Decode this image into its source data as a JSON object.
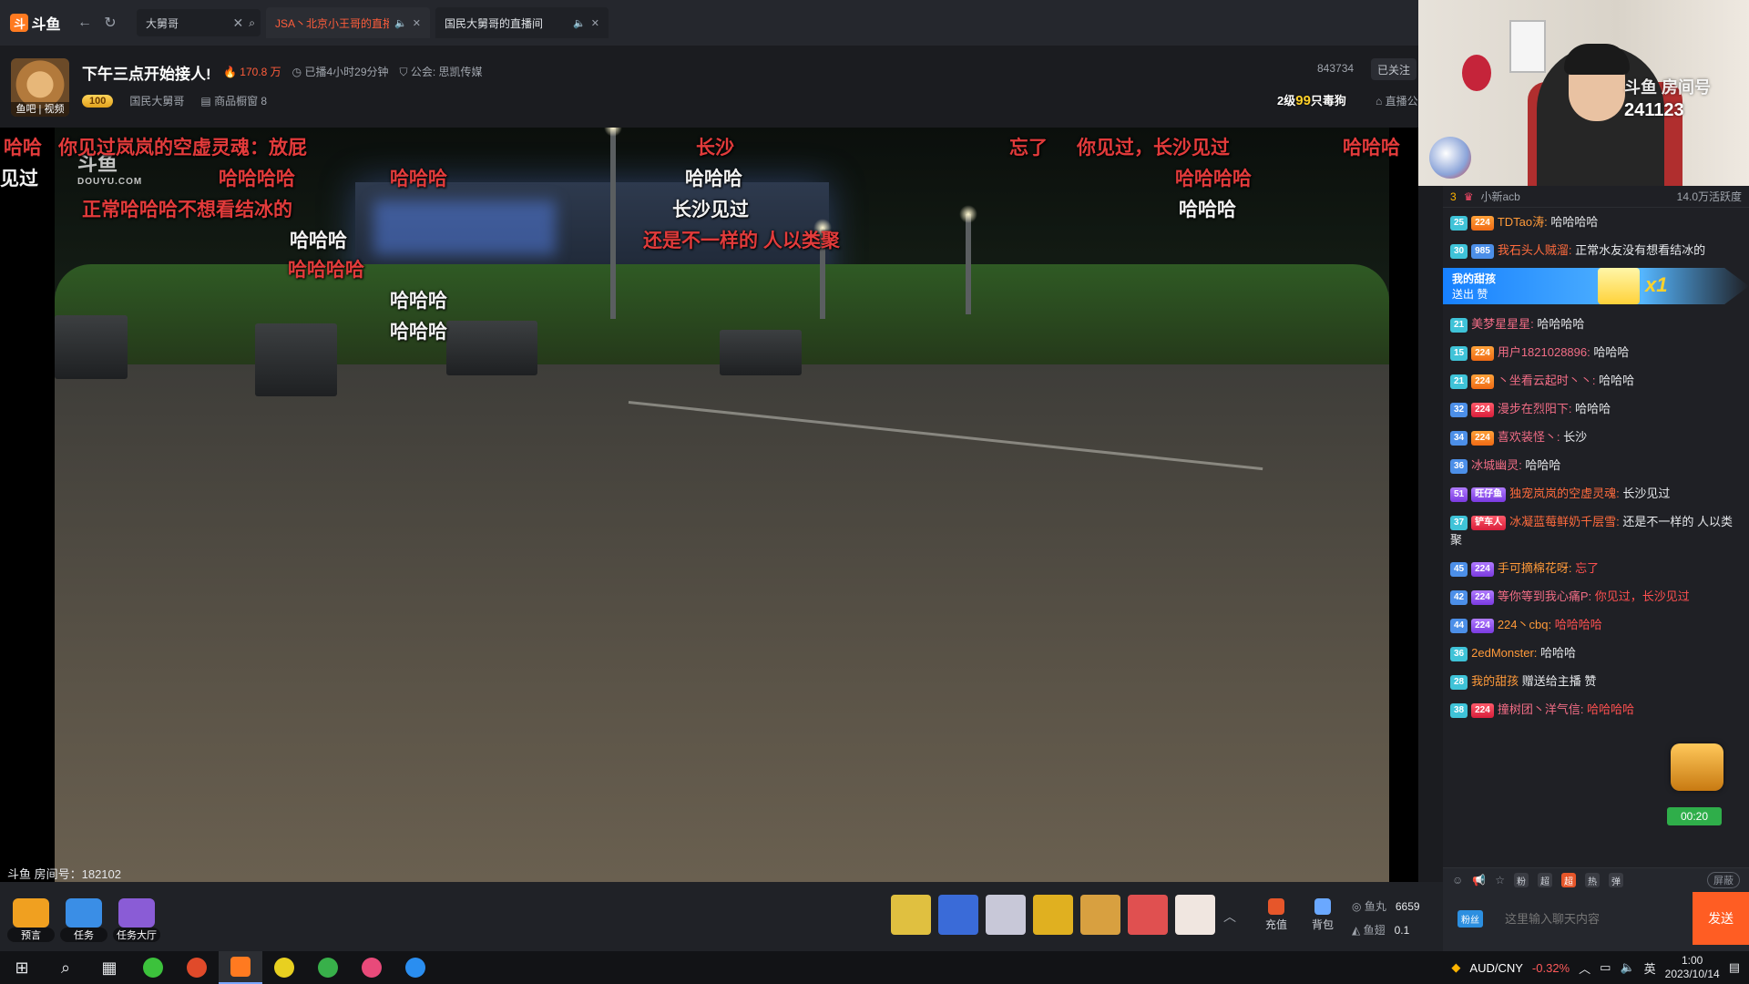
{
  "app": {
    "logo": "斗鱼",
    "brand_color": "#ff7a20"
  },
  "nav": {
    "back": "←",
    "refresh": "↻"
  },
  "search": {
    "value": "大舅哥"
  },
  "tabs": [
    {
      "label": "JSA丶北京小王哥的直播间",
      "active": true
    },
    {
      "label": "国民大舅哥的直播间",
      "active": false
    }
  ],
  "room": {
    "avatar_tag": "鱼吧 | 视频",
    "title": "下午三点开始接人!",
    "heat": "170.8 万",
    "duration": "已播4小时29分钟",
    "guild": "公会: 思凯传媒",
    "level_badge": "100",
    "anchor_name": "国民大舅哥",
    "shop": "商品橱窗 8",
    "viewer_id": "843734",
    "follow_label": "已关注",
    "gift_rank_prefix": "2级",
    "gift_rank_value": "99",
    "gift_rank_suffix": "只毒狗",
    "live_link": "直播公"
  },
  "video": {
    "watermark": "斗鱼",
    "watermark_sub": "DOUYU.COM",
    "room_number": "斗鱼 房间号：182102",
    "danmaku": [
      {
        "text": "哈哈",
        "color": "red",
        "pos": "a"
      },
      {
        "text": "你见过岚岚的空虚灵魂：放屁",
        "color": "red",
        "pos": "b"
      },
      {
        "text": "见过",
        "color": "white",
        "pos": "c"
      },
      {
        "text": "哈哈哈哈",
        "color": "red",
        "pos": "d"
      },
      {
        "text": "哈哈哈",
        "color": "red",
        "pos": "e"
      },
      {
        "text": "正常哈哈哈不想看结冰的",
        "color": "red",
        "pos": "f"
      },
      {
        "text": "哈哈哈",
        "color": "white",
        "pos": "g"
      },
      {
        "text": "哈哈哈哈",
        "color": "red",
        "pos": "h"
      },
      {
        "text": "哈哈哈",
        "color": "white",
        "pos": "i"
      },
      {
        "text": "哈哈哈",
        "color": "white",
        "pos": "j"
      },
      {
        "text": "长沙",
        "color": "red",
        "pos": "k"
      },
      {
        "text": "哈哈哈",
        "color": "white",
        "pos": "l"
      },
      {
        "text": "长沙见过",
        "color": "white",
        "pos": "m"
      },
      {
        "text": "还是不一样的 人以类聚",
        "color": "red",
        "pos": "n"
      },
      {
        "text": "忘了",
        "color": "red",
        "pos": "o"
      },
      {
        "text": "你见过，长沙见过",
        "color": "red",
        "pos": "p"
      },
      {
        "text": "哈哈哈哈",
        "color": "red",
        "pos": "q"
      },
      {
        "text": "哈哈哈",
        "color": "white",
        "pos": "r"
      },
      {
        "text": "哈哈哈",
        "color": "red",
        "pos": "s"
      }
    ]
  },
  "cam": {
    "watermark": "斗鱼",
    "room_label": "房间号",
    "room_number": "241123"
  },
  "chat": {
    "header_rank": "3",
    "header_user": "小新acb",
    "header_active": "14.0万活跃度",
    "gift_banner": {
      "line1": "我的甜孩",
      "line2": "送出 赞",
      "count": "x1"
    },
    "messages": [
      {
        "lv": "25",
        "fan": "224",
        "nick": "TDTao涛:",
        "text": "哈哈哈哈"
      },
      {
        "lv": "30",
        "fan": "985",
        "nick": "我石头人贼溜:",
        "text": "正常水友没有想看结冰的"
      },
      {
        "lv": "21",
        "fan": "",
        "nick": "美梦星星星:",
        "text": "哈哈哈哈"
      },
      {
        "lv": "15",
        "fan": "224",
        "nick": "用户1821028896:",
        "text": "哈哈哈"
      },
      {
        "lv": "21",
        "fan": "224",
        "nick": "丶坐看云起时丶丶:",
        "text": "哈哈哈"
      },
      {
        "lv": "32",
        "fan": "224",
        "nick": "漫步在烈阳下:",
        "text": "哈哈哈"
      },
      {
        "lv": "34",
        "fan": "224",
        "nick": "喜欢装怪丶:",
        "text": "长沙"
      },
      {
        "lv": "36",
        "fan": "",
        "nick": "冰城幽灵:",
        "text": "哈哈哈"
      },
      {
        "lv": "51",
        "fan": "旺仔鱼",
        "nick": "独宠岚岚的空虚灵魂:",
        "text": "长沙见过"
      },
      {
        "lv": "37",
        "fan": "铲车人",
        "nick": "冰凝蓝莓鲜奶千层雪:",
        "text": "还是不一样的 人以类聚"
      },
      {
        "lv": "45",
        "fan": "224",
        "nick": "手可摘棉花呀:",
        "text": "忘了"
      },
      {
        "lv": "42",
        "fan": "224",
        "nick": "等你等到我心痛P:",
        "text": "你见过，长沙见过"
      },
      {
        "lv": "44",
        "fan": "224",
        "nick": "224丶cbq:",
        "text": "哈哈哈哈"
      },
      {
        "lv": "36",
        "fan": "",
        "nick": "2edMonster:",
        "text": "哈哈哈"
      },
      {
        "lv": "28",
        "fan": "",
        "nick": "我的甜孩",
        "text": "赠送给主播 赞"
      },
      {
        "lv": "38",
        "fan": "224",
        "nick": "撞树团丶洋气信:",
        "text": "哈哈哈哈"
      }
    ],
    "timer": "00:20",
    "input_placeholder": "这里输入聊天内容",
    "send_label": "发送",
    "fans_label": "粉丝",
    "shield_label": "屏蔽",
    "tool_chips": [
      "粉",
      "超",
      "超",
      "热",
      "弹"
    ]
  },
  "toolbar": {
    "left_items": [
      {
        "label": "预言",
        "color": "#f0a020"
      },
      {
        "label": "任务",
        "color": "#3a8ee6"
      },
      {
        "label": "任务大厅",
        "color": "#8a5cd6"
      }
    ],
    "gift_colors": [
      "#e0c040",
      "#3a6bd8",
      "#e04040",
      "#e0b020",
      "#d8a040",
      "#e05050",
      "#f0f0f0"
    ],
    "recharge_label": "充值",
    "bag_label": "背包",
    "yuwan_label": "鱼丸",
    "yuwan_value": "6659",
    "yuchi_label": "鱼翅",
    "yuchi_value": "0.1"
  },
  "taskbar": {
    "fx_pair": "AUD/CNY",
    "fx_change": "-0.32%",
    "ime": "英",
    "time": "1:00",
    "date": "2023/10/14"
  }
}
